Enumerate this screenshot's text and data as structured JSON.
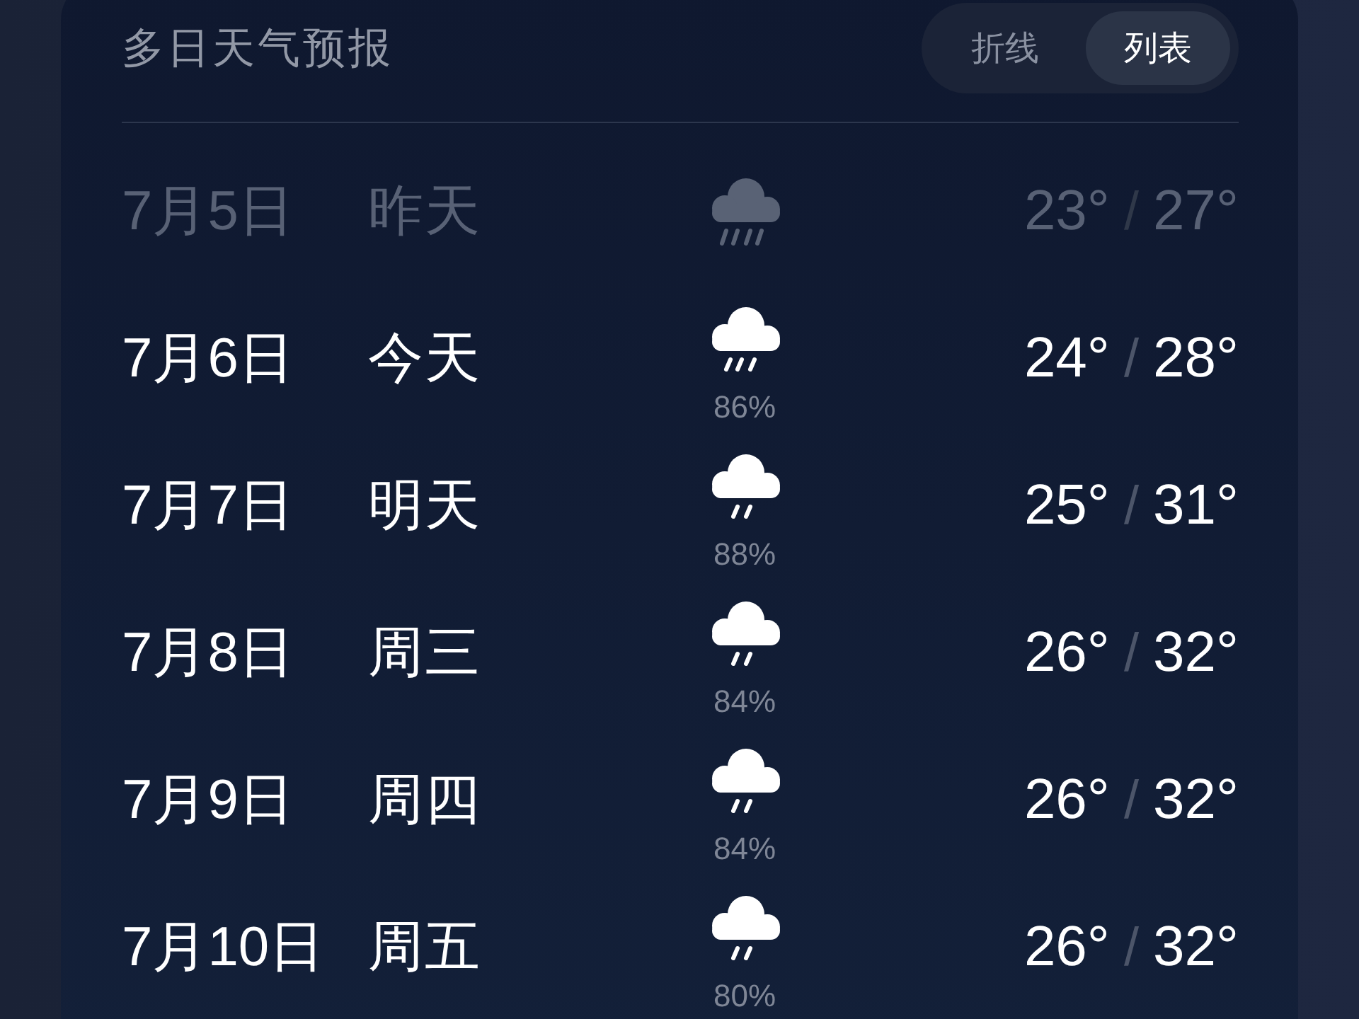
{
  "header": {
    "title": "多日天气预报",
    "view_toggle": [
      {
        "label": "折线",
        "selected": false
      },
      {
        "label": "列表",
        "selected": true
      }
    ]
  },
  "days": [
    {
      "date": "7月5日",
      "day": "昨天",
      "past": true,
      "kind": "heavy",
      "low": "23°",
      "separator": "/",
      "high": "27°"
    },
    {
      "date": "7月6日",
      "day": "今天",
      "past": false,
      "kind": "moderate",
      "precip": "86%",
      "low": "24°",
      "separator": "/",
      "high": "28°"
    },
    {
      "date": "7月7日",
      "day": "明天",
      "past": false,
      "kind": "light",
      "precip": "88%",
      "low": "25°",
      "separator": "/",
      "high": "31°"
    },
    {
      "date": "7月8日",
      "day": "周三",
      "past": false,
      "kind": "light",
      "precip": "84%",
      "low": "26°",
      "separator": "/",
      "high": "32°"
    },
    {
      "date": "7月9日",
      "day": "周四",
      "past": false,
      "kind": "light",
      "precip": "84%",
      "low": "26°",
      "separator": "/",
      "high": "32°"
    },
    {
      "date": "7月10日",
      "day": "周五",
      "past": false,
      "kind": "light",
      "precip": "80%",
      "low": "26°",
      "separator": "/",
      "high": "32°"
    }
  ]
}
